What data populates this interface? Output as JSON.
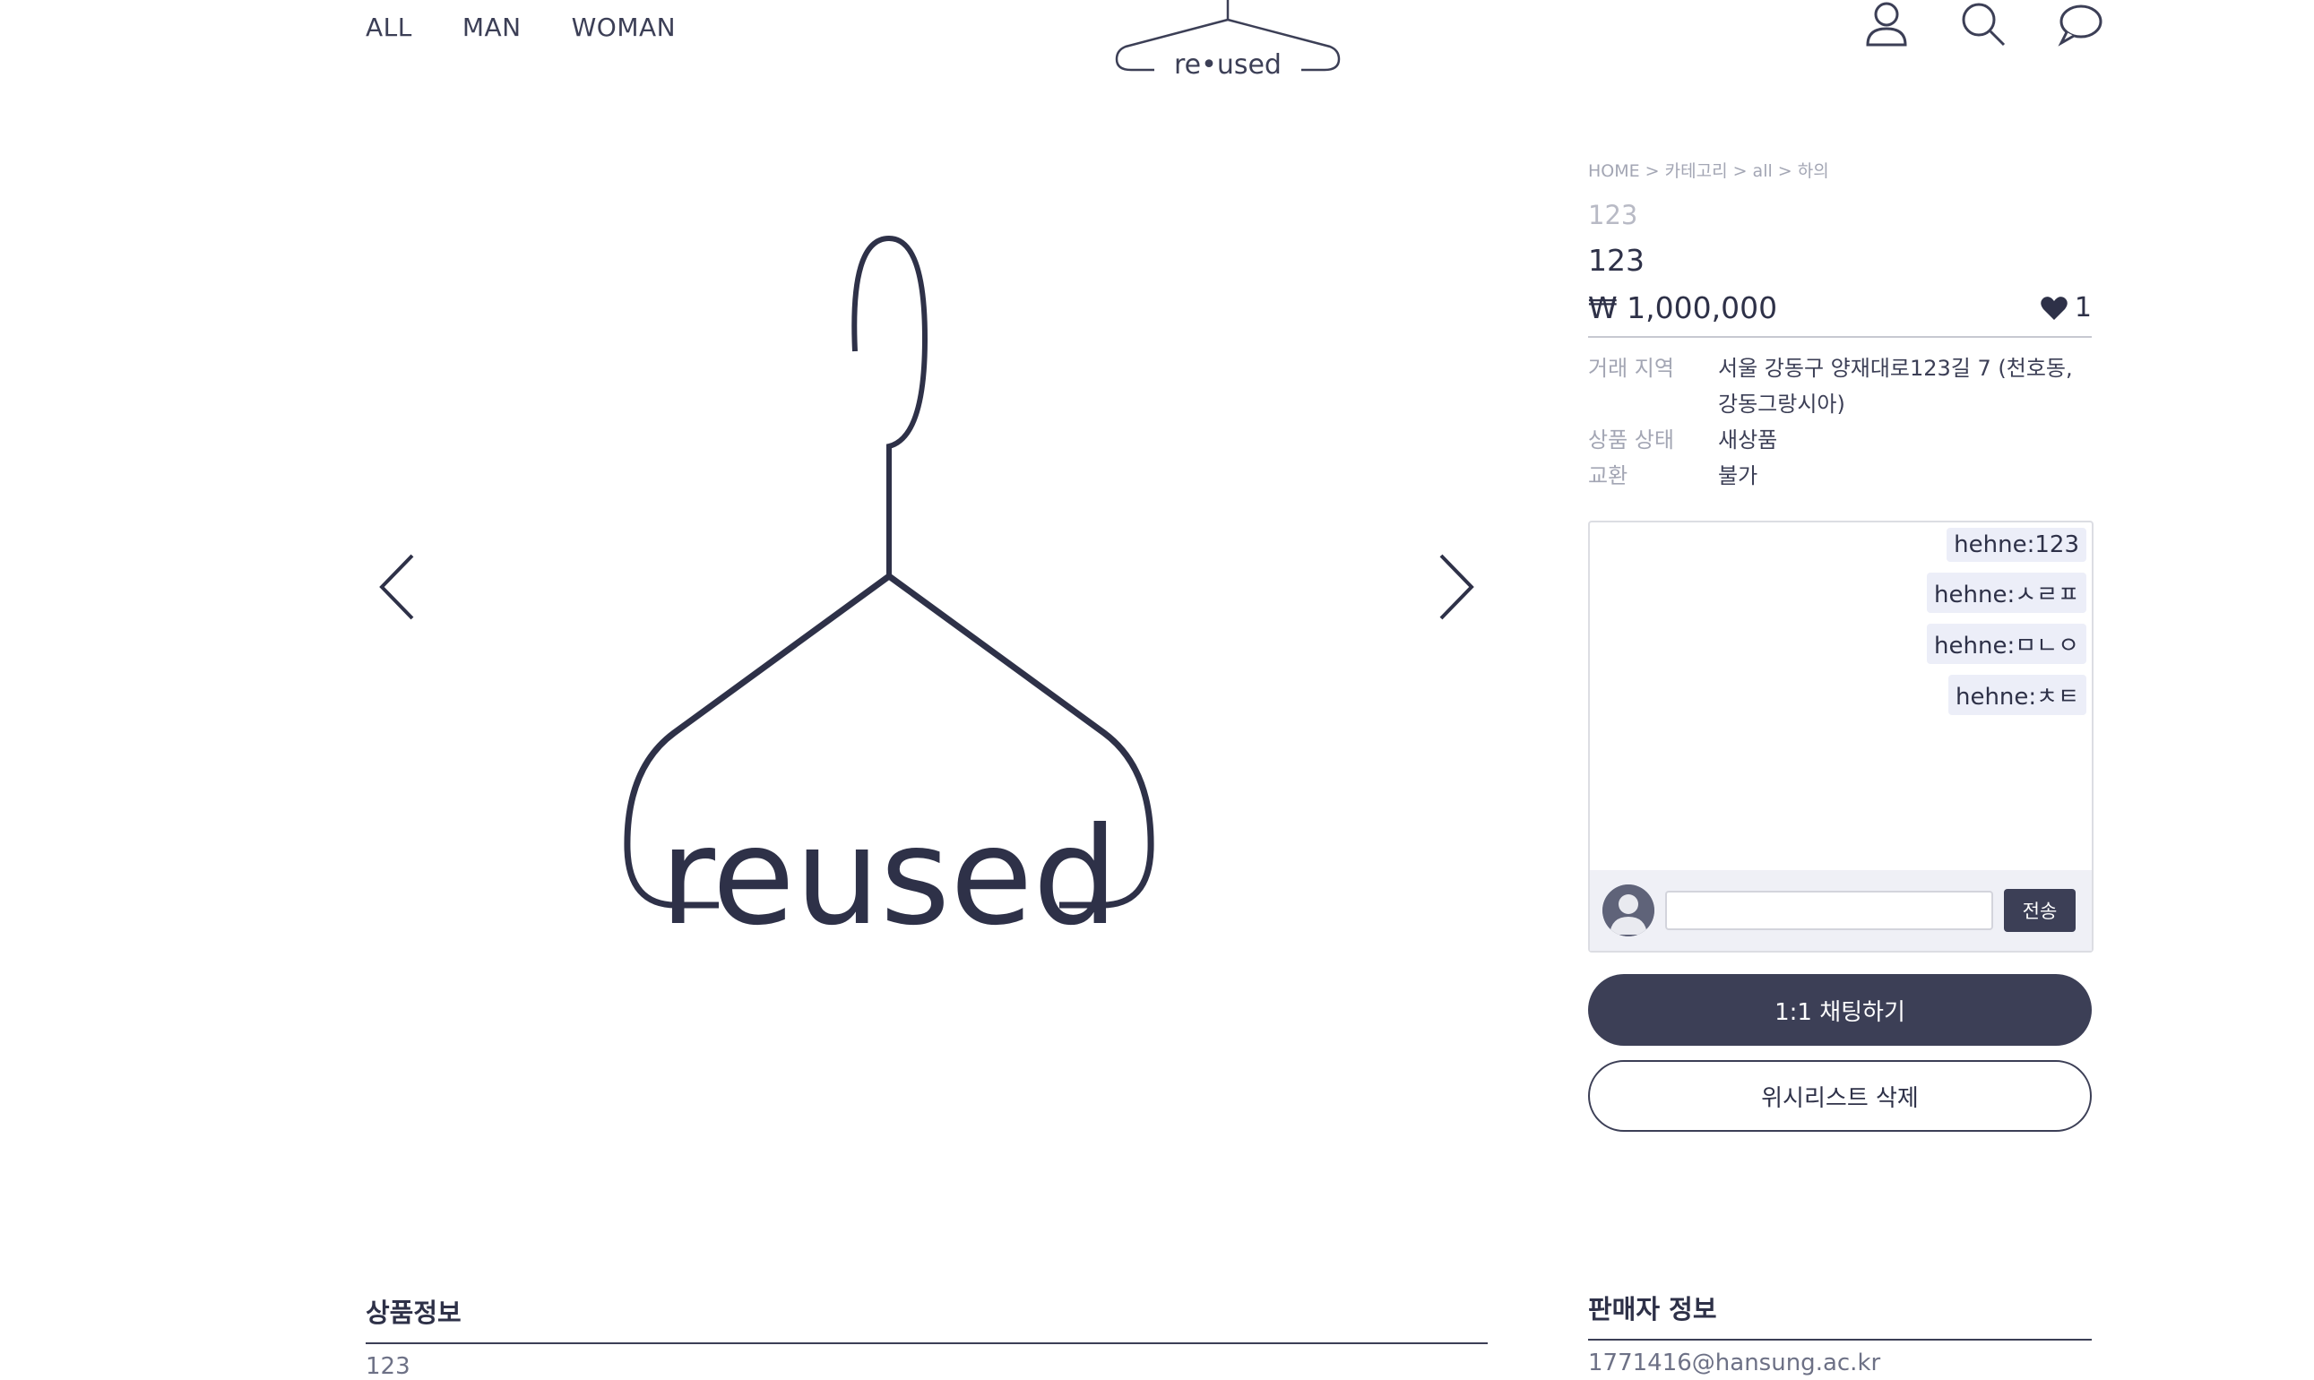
{
  "nav": {
    "items": [
      "ALL",
      "MAN",
      "WOMAN"
    ]
  },
  "logo": {
    "text": "reused"
  },
  "header_icons": [
    "user-icon",
    "search-icon",
    "chat-bubble-icon"
  ],
  "product": {
    "breadcrumb": "HOME > 카테고리 > all > 하의",
    "sub_title": "123",
    "title": "123",
    "price": "₩  1,000,000",
    "likes": "1",
    "info": [
      {
        "label": "거래 지역",
        "value": "서울 강동구 양재대로123길 7 (천호동, 강동그랑시아)"
      },
      {
        "label": "상품 상태",
        "value": "새상품"
      },
      {
        "label": "교환",
        "value": "불가"
      }
    ]
  },
  "chat": {
    "messages": [
      "hehne:123",
      "hehne:ㅅㄹㅍ",
      "hehne:ㅁㄴㅇ",
      "hehne:ㅊㅌ"
    ],
    "input_value": "",
    "send_label": "전송"
  },
  "buttons": {
    "chat_label": "1:1 채팅하기",
    "wishlist_label": "위시리스트 삭제"
  },
  "sections": {
    "product_info_title": "상품정보",
    "product_info_body": "123",
    "seller_info_title": "판매자 정보",
    "seller_info_body": "1771416@hansung.ac.kr"
  },
  "colors": {
    "accent": "#3c3f56",
    "bubble": "#eceef8",
    "muted": "#a3a6b4"
  }
}
